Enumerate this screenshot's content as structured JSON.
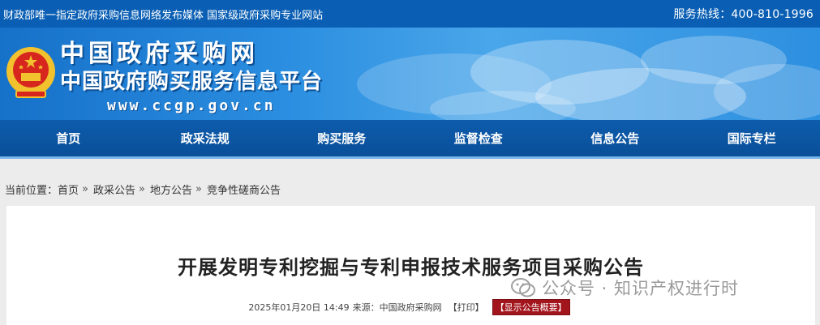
{
  "topbar": {
    "slogan": "财政部唯一指定政府采购信息网络发布媒体 国家级政府采购专业网站",
    "hotline": "服务热线：400-810-1996"
  },
  "header": {
    "logo_line1": "中国政府采购网",
    "logo_line2": "中国政府购买服务信息平台",
    "logo_url": "www.ccgp.gov.cn",
    "emblem_icon": "national-emblem-icon"
  },
  "nav": {
    "items": [
      {
        "label": "首页"
      },
      {
        "label": "政采法规"
      },
      {
        "label": "购买服务"
      },
      {
        "label": "监督检查"
      },
      {
        "label": "信息公告"
      },
      {
        "label": "国际专栏"
      }
    ]
  },
  "breadcrumb": {
    "prefix": "当前位置：",
    "items": [
      {
        "label": "首页"
      },
      {
        "label": "政采公告"
      },
      {
        "label": "地方公告"
      },
      {
        "label": "竞争性磋商公告"
      }
    ],
    "separator": "»"
  },
  "article": {
    "title": "开展发明专利挖掘与专利申报技术服务项目采购公告",
    "datetime": "2025年01月20日 14:49",
    "source": "来源：中国政府采购网",
    "print_label": "【打印】",
    "summary_label": "【显示公告概要】"
  },
  "watermark": {
    "text": "公众号 · 知识产权进行时",
    "icon": "wechat-icon"
  },
  "colors": {
    "topbar": "#0a5fb4",
    "nav": "#0d5cac",
    "summary_button": "#a3151d"
  }
}
